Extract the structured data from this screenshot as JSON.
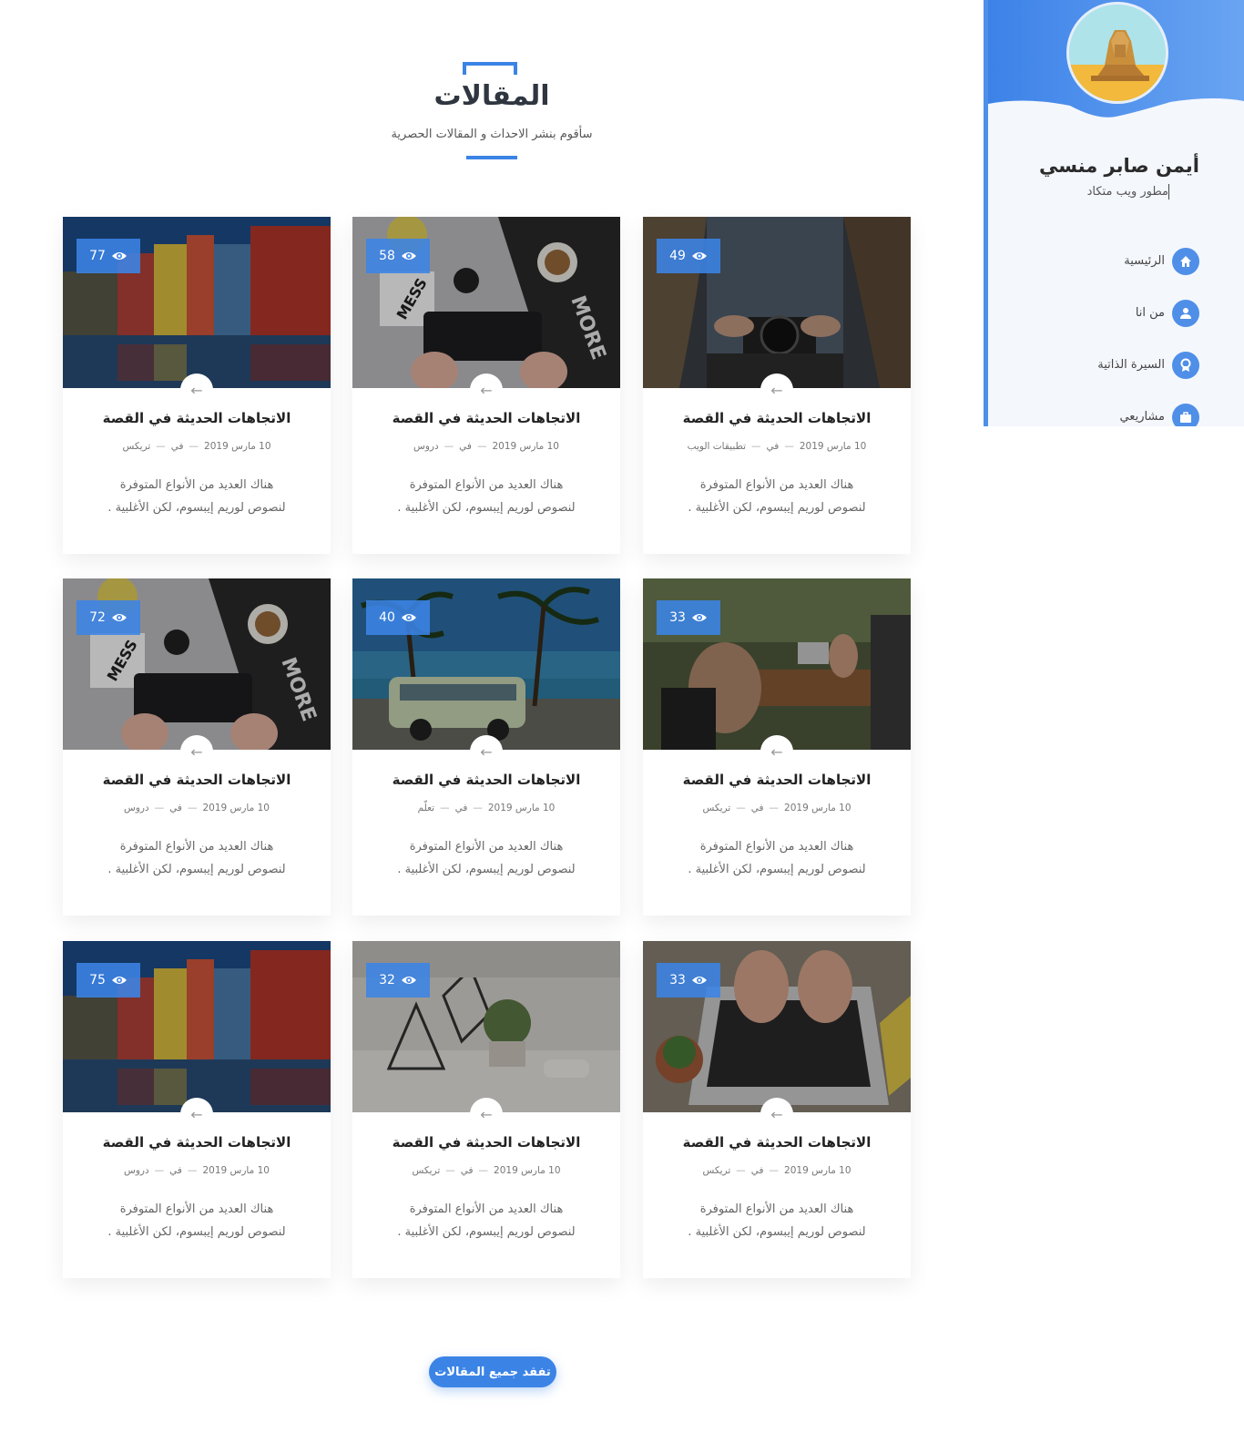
{
  "section": {
    "title": "المقالات",
    "subtitle": "سأقوم بنشر الاحداث و المقالات الحصرية"
  },
  "cards": [
    {
      "views": "49",
      "title": "الاتجاهات الحديثة في القصة",
      "date": "10 مارس 2019",
      "in": "في",
      "category": "تطبيقات الويب",
      "excerpt_line1": "هناك العديد من الأنواع المتوفرة",
      "excerpt_line2": "لنصوص لوريم إيبسوم، لكن الأغلبية .",
      "image": "camera-woman"
    },
    {
      "views": "58",
      "title": "الاتجاهات الحديثة في القصة",
      "date": "10 مارس 2019",
      "in": "في",
      "category": "دروس",
      "excerpt_line1": "هناك العديد من الأنواع المتوفرة",
      "excerpt_line2": "لنصوص لوريم إيبسوم، لكن الأغلبية .",
      "image": "keyboard-desk"
    },
    {
      "views": "77",
      "title": "الاتجاهات الحديثة في القصة",
      "date": "10 مارس 2019",
      "in": "في",
      "category": "تريكس",
      "excerpt_line1": "هناك العديد من الأنواع المتوفرة",
      "excerpt_line2": "لنصوص لوريم إيبسوم، لكن الأغلبية .",
      "image": "colorful-houses"
    },
    {
      "views": "33",
      "title": "الاتجاهات الحديثة في القصة",
      "date": "10 مارس 2019",
      "in": "في",
      "category": "تريكس",
      "excerpt_line1": "هناك العديد من الأنواع المتوفرة",
      "excerpt_line2": "لنصوص لوريم إيبسوم، لكن الأغلبية .",
      "image": "cafe-working"
    },
    {
      "views": "40",
      "title": "الاتجاهات الحديثة في القصة",
      "date": "10 مارس 2019",
      "in": "في",
      "category": "تعلّم",
      "excerpt_line1": "هناك العديد من الأنواع المتوفرة",
      "excerpt_line2": "لنصوص لوريم إيبسوم، لكن الأغلبية .",
      "image": "van-beach"
    },
    {
      "views": "72",
      "title": "الاتجاهات الحديثة في القصة",
      "date": "10 مارس 2019",
      "in": "في",
      "category": "دروس",
      "excerpt_line1": "هناك العديد من الأنواع المتوفرة",
      "excerpt_line2": "لنصوص لوريم إيبسوم، لكن الأغلبية .",
      "image": "keyboard-desk"
    },
    {
      "views": "33",
      "title": "الاتجاهات الحديثة في القصة",
      "date": "10 مارس 2019",
      "in": "في",
      "category": "تريكس",
      "excerpt_line1": "هناك العديد من الأنواع المتوفرة",
      "excerpt_line2": "لنصوص لوريم إيبسوم، لكن الأغلبية .",
      "image": "laptop-typing"
    },
    {
      "views": "32",
      "title": "الاتجاهات الحديثة في القصة",
      "date": "10 مارس 2019",
      "in": "في",
      "category": "تريكس",
      "excerpt_line1": "هناك العديد من الأنواع المتوفرة",
      "excerpt_line2": "لنصوص لوريم إيبسوم، لكن الأغلبية .",
      "image": "terrarium-desk"
    },
    {
      "views": "75",
      "title": "الاتجاهات الحديثة في القصة",
      "date": "10 مارس 2019",
      "in": "في",
      "category": "دروس",
      "excerpt_line1": "هناك العديد من الأنواع المتوفرة",
      "excerpt_line2": "لنصوص لوريم إيبسوم، لكن الأغلبية .",
      "image": "colorful-houses"
    }
  ],
  "more_button": "تفقد جميع المقالات",
  "sidebar": {
    "avatar_icon": "sphinx-icon",
    "name": "أيمن صابر منسي",
    "role": "مطور ويب متكاد",
    "nav": [
      {
        "label": "الرئيسية",
        "icon": "home-icon"
      },
      {
        "label": "من انا",
        "icon": "user-icon"
      },
      {
        "label": "السيرة الذاتية",
        "icon": "award-icon"
      },
      {
        "label": "مشاريعي",
        "icon": "briefcase-icon"
      }
    ]
  },
  "colors": {
    "accent": "#3b84e6",
    "sidebar_header": "#4f8fe8"
  }
}
